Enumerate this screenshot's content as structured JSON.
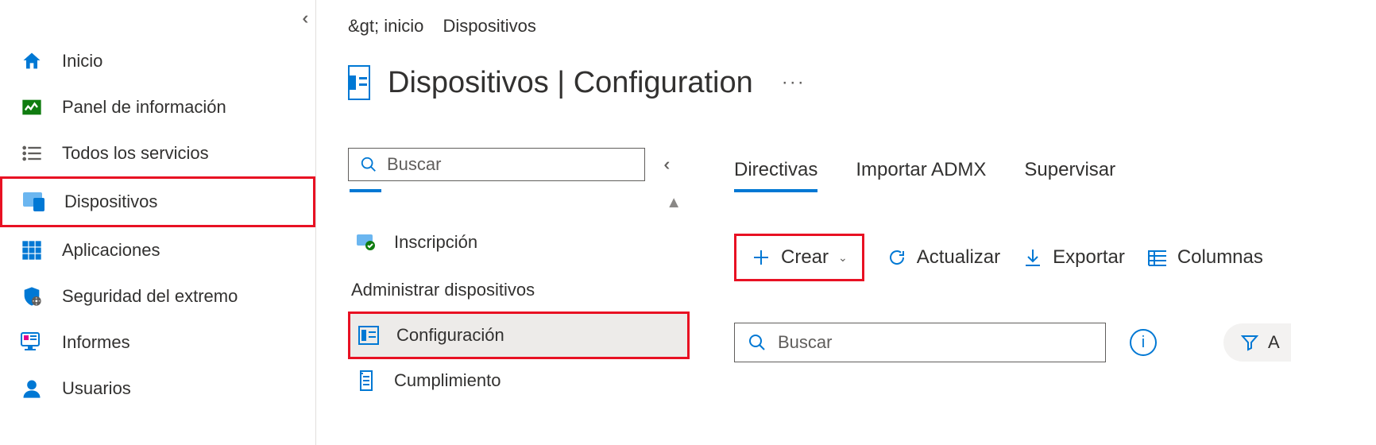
{
  "sidebar": {
    "items": [
      {
        "label": "Inicio"
      },
      {
        "label": "Panel de información"
      },
      {
        "label": "Todos los servicios"
      },
      {
        "label": "Dispositivos"
      },
      {
        "label": "Aplicaciones"
      },
      {
        "label": "Seguridad del extremo"
      },
      {
        "label": "Informes"
      },
      {
        "label": "Usuarios"
      }
    ]
  },
  "breadcrumb": {
    "part0": "&gt; inicio",
    "part1": "Dispositivos"
  },
  "page_title": "Dispositivos | Configuration",
  "mid_search_placeholder": "Buscar",
  "subnav": {
    "item_inscripcion": "Inscripción",
    "heading_manage": "Administrar dispositivos",
    "item_configuracion": "Configuración",
    "item_cumplimiento": "Cumplimiento"
  },
  "tabs": {
    "t0": "Directivas",
    "t1": "Importar ADMX",
    "t2": "Supervisar"
  },
  "toolbar": {
    "create": "Crear",
    "refresh": "Actualizar",
    "export": "Exportar",
    "columns": "Columnas"
  },
  "results_search_placeholder": "Buscar",
  "filter_label": "A"
}
